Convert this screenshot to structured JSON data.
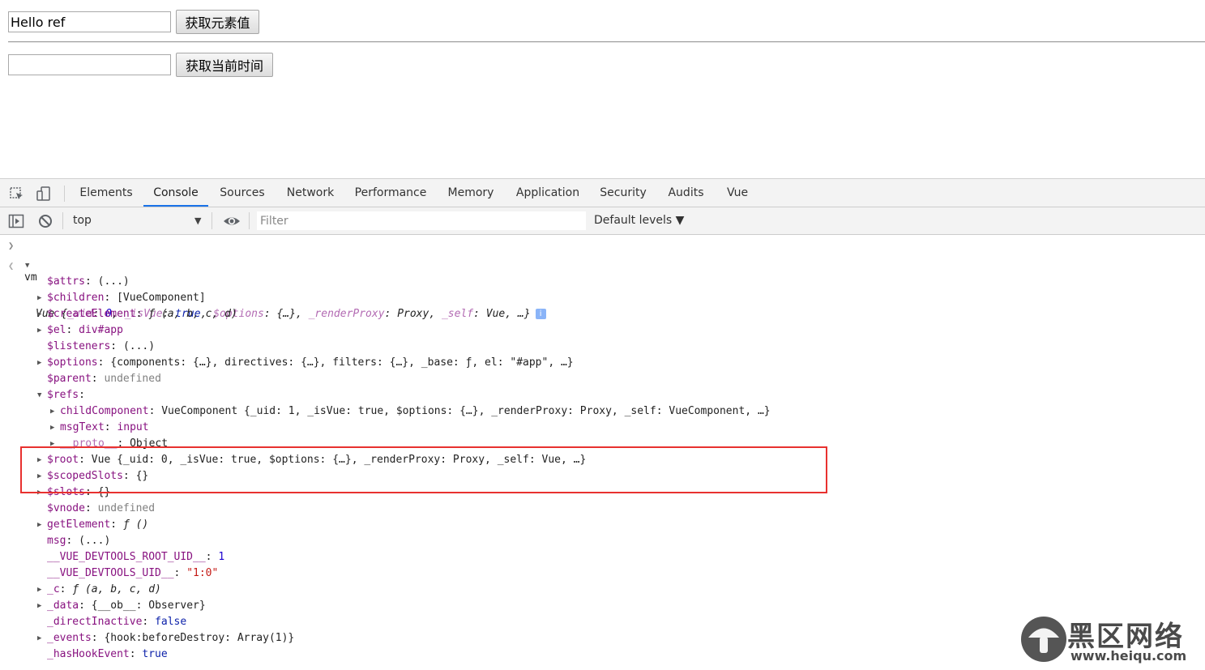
{
  "page": {
    "input1_value": "Hello ref",
    "button1_label": "获取元素值",
    "input2_value": "",
    "button2_label": "获取当前时间"
  },
  "devtools": {
    "tabs": [
      "Elements",
      "Console",
      "Sources",
      "Network",
      "Performance",
      "Memory",
      "Application",
      "Security",
      "Audits",
      "Vue"
    ],
    "active_tab": "Console",
    "context": "top",
    "filter_placeholder": "Filter",
    "levels_label": "Default levels ▼"
  },
  "console": {
    "input_command": "vm",
    "result_summary": {
      "class": "Vue",
      "open": "{",
      "uid_key": "_uid",
      "uid_val": "0",
      "isvue_key": "_isVue",
      "isvue_val": "true",
      "options_key": "$options",
      "options_val": "{…}",
      "renderproxy_key": "_renderProxy",
      "renderproxy_val": "Proxy",
      "self_key": "_self",
      "self_val": "Vue",
      "close": "…}"
    },
    "properties": [
      {
        "key": "$attrs",
        "value": "(...)",
        "type": "val",
        "expandable": false,
        "indent": 0
      },
      {
        "key": "$children",
        "value": "[VueComponent]",
        "type": "val",
        "expandable": true,
        "indent": 0
      },
      {
        "key": "$createElement",
        "value": "ƒ (a, b, c, d)",
        "type": "fn",
        "expandable": true,
        "indent": 0
      },
      {
        "key": "$el",
        "value": "div#app",
        "type": "node",
        "expandable": true,
        "indent": 0
      },
      {
        "key": "$listeners",
        "value": "(...)",
        "type": "val",
        "expandable": false,
        "indent": 0
      },
      {
        "key": "$options",
        "value": "{components: {…}, directives: {…}, filters: {…}, _base: ƒ, el: \"#app\", …}",
        "type": "val",
        "expandable": true,
        "indent": 0
      },
      {
        "key": "$parent",
        "value": "undefined",
        "type": "undef",
        "expandable": false,
        "indent": 0
      },
      {
        "key": "$refs",
        "value": "",
        "type": "val",
        "expandable": true,
        "expanded": true,
        "indent": 0
      },
      {
        "key": "childComponent",
        "value": "VueComponent {_uid: 1, _isVue: true, $options: {…}, _renderProxy: Proxy, _self: VueComponent, …}",
        "type": "val",
        "expandable": true,
        "indent": 1
      },
      {
        "key": "msgText",
        "value": "input",
        "type": "node",
        "expandable": true,
        "indent": 1
      },
      {
        "key": "__proto__",
        "value": "Object",
        "type": "val",
        "expandable": true,
        "indent": 1,
        "dim": true
      },
      {
        "key": "$root",
        "value": "Vue {_uid: 0, _isVue: true, $options: {…}, _renderProxy: Proxy, _self: Vue, …}",
        "type": "val",
        "expandable": true,
        "indent": 0
      },
      {
        "key": "$scopedSlots",
        "value": "{}",
        "type": "val",
        "expandable": true,
        "indent": 0
      },
      {
        "key": "$slots",
        "value": "{}",
        "type": "val",
        "expandable": true,
        "indent": 0
      },
      {
        "key": "$vnode",
        "value": "undefined",
        "type": "undef",
        "expandable": false,
        "indent": 0
      },
      {
        "key": "getElement",
        "value": "ƒ ()",
        "type": "fn",
        "expandable": true,
        "indent": 0
      },
      {
        "key": "msg",
        "value": "(...)",
        "type": "val",
        "expandable": false,
        "indent": 0
      },
      {
        "key": "__VUE_DEVTOOLS_ROOT_UID__",
        "value": "1",
        "type": "num",
        "expandable": false,
        "indent": 0
      },
      {
        "key": "__VUE_DEVTOOLS_UID__",
        "value": "\"1:0\"",
        "type": "str",
        "expandable": false,
        "indent": 0
      },
      {
        "key": "_c",
        "value": "ƒ (a, b, c, d)",
        "type": "fn",
        "expandable": true,
        "indent": 0
      },
      {
        "key": "_data",
        "value": "{__ob__: Observer}",
        "type": "val",
        "expandable": true,
        "indent": 0
      },
      {
        "key": "_directInactive",
        "value": "false",
        "type": "bool",
        "expandable": false,
        "indent": 0
      },
      {
        "key": "_events",
        "value": "{hook:beforeDestroy: Array(1)}",
        "type": "val",
        "expandable": true,
        "indent": 0
      },
      {
        "key": "_hasHookEvent",
        "value": "true",
        "type": "bool",
        "expandable": false,
        "indent": 0
      }
    ]
  },
  "watermark": {
    "title": "黑区网络",
    "url": "www.heiqu.com"
  },
  "colors": {
    "accent": "#1a73e8",
    "highlight_box": "#e8312f",
    "key": "#881280",
    "number": "#1c00cf",
    "string": "#c41a16"
  }
}
